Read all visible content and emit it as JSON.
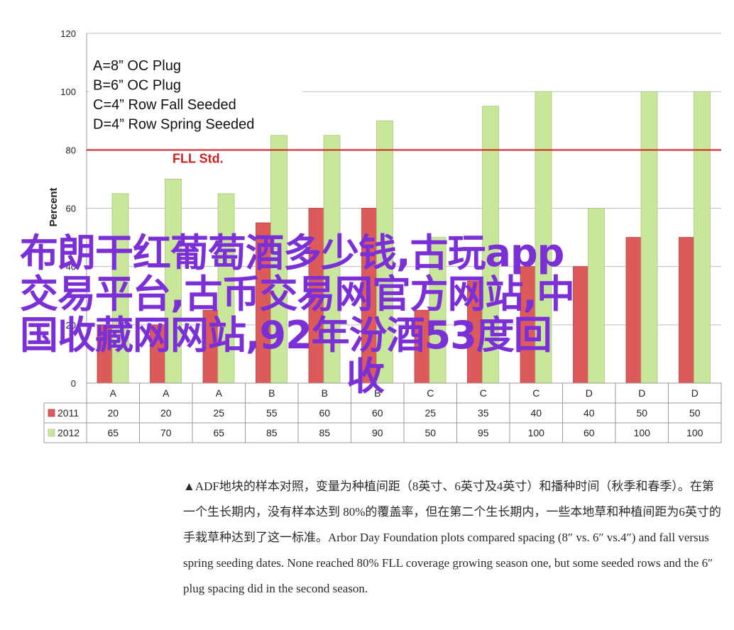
{
  "chart_data": {
    "type": "bar",
    "ylabel": "Percent",
    "ylim": [
      0,
      120
    ],
    "yticks": [
      0,
      20,
      40,
      60,
      80,
      100,
      120
    ],
    "categories": [
      "A",
      "A",
      "A",
      "B",
      "B",
      "B",
      "C",
      "C",
      "C",
      "D",
      "D",
      "D"
    ],
    "series": [
      {
        "name": "2011",
        "color": "#dd5a5a",
        "values": [
          20,
          20,
          25,
          55,
          60,
          60,
          25,
          35,
          40,
          40,
          50,
          50
        ]
      },
      {
        "name": "2012",
        "color": "#c9e79a",
        "values": [
          65,
          70,
          65,
          85,
          85,
          90,
          50,
          95,
          100,
          60,
          100,
          100
        ]
      }
    ],
    "reference_line": {
      "label": "FLL Std.",
      "value": 80,
      "color": "#cc2222"
    },
    "legend_box": [
      "A=8” OC Plug",
      "B=6” OC Plug",
      "C=4” Row Fall Seeded",
      "D=4” Row Spring Seeded"
    ],
    "grid": true
  },
  "watermark": {
    "line1": "布朗干红葡萄酒多少钱,古玩app",
    "line2": "交易平台,古币交易网官方网站,中",
    "line3": "国收藏网网站,92年汾酒53度回",
    "line4": "收"
  },
  "caption": "▲ADF地块的样本对照，变量为种植间距（8英寸、6英寸及4英寸）和播种时间（秋季和春季）。在第一个生长期内，没有样本达到 80%的覆盖率，但在第二个生长期内，一些本地草和种植间距为6英寸的手栽草种达到了这一标准。Arbor Day Foundation plots compared spacing (8″ vs. 6″ vs.4″) and fall versus spring seeding dates. None reached 80% FLL coverage growing season one, but some seeded rows and the 6″ plug spacing did in the second season."
}
